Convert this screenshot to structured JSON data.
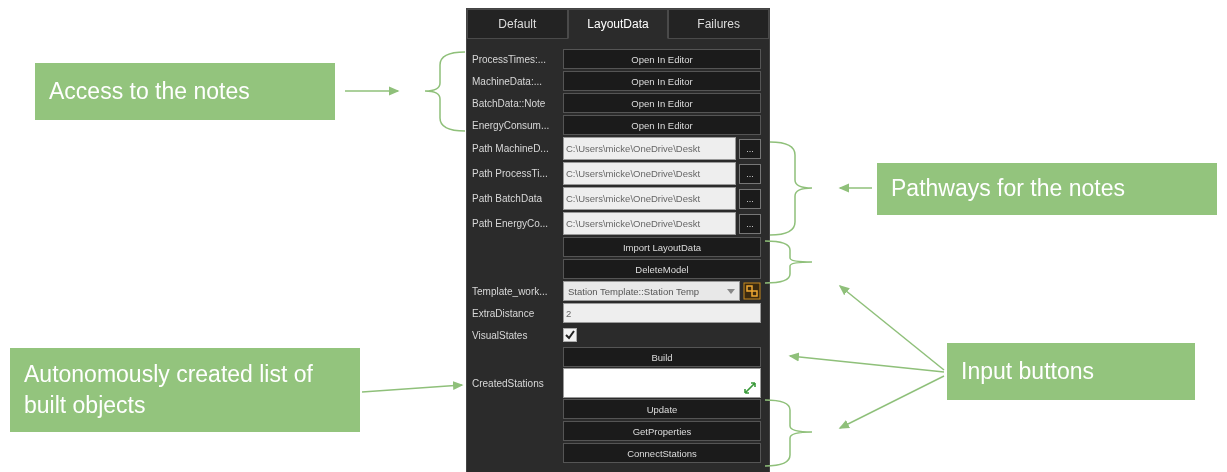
{
  "tabs": [
    {
      "label": "Default",
      "selected": false
    },
    {
      "label": "LayoutData",
      "selected": true
    },
    {
      "label": "Failures",
      "selected": false
    }
  ],
  "properties": [
    {
      "kind": "button",
      "label": "ProcessTimes:...",
      "button": "Open In Editor"
    },
    {
      "kind": "button",
      "label": "MachineData:...",
      "button": "Open In Editor"
    },
    {
      "kind": "button",
      "label": "BatchData::Note",
      "button": "Open In Editor"
    },
    {
      "kind": "button",
      "label": "EnergyConsum...",
      "button": "Open In Editor"
    },
    {
      "kind": "path",
      "label": "Path MachineD...",
      "value": "C:\\Users\\micke\\OneDrive\\Deskt",
      "browse": "..."
    },
    {
      "kind": "path",
      "label": "Path ProcessTi...",
      "value": "C:\\Users\\micke\\OneDrive\\Deskt",
      "browse": "..."
    },
    {
      "kind": "path",
      "label": "Path BatchData",
      "value": "C:\\Users\\micke\\OneDrive\\Deskt",
      "browse": "..."
    },
    {
      "kind": "path",
      "label": "Path EnergyCo...",
      "value": "C:\\Users\\micke\\OneDrive\\Deskt",
      "browse": "..."
    },
    {
      "kind": "action",
      "button": "Import LayoutData"
    },
    {
      "kind": "action",
      "button": "DeleteModel"
    },
    {
      "kind": "dropdown",
      "label": "Template_work...",
      "value": "Station Template::Station Temp"
    },
    {
      "kind": "text",
      "label": "ExtraDistance",
      "value": "2"
    },
    {
      "kind": "checkbox",
      "label": "VisualStates",
      "checked": true
    },
    {
      "kind": "action",
      "button": "Build"
    },
    {
      "kind": "list",
      "label": "CreatedStations"
    },
    {
      "kind": "action",
      "button": "Update"
    },
    {
      "kind": "action",
      "button": "GetProperties"
    },
    {
      "kind": "action",
      "button": "ConnectStations"
    }
  ],
  "callouts": [
    {
      "text": "Access to the notes"
    },
    {
      "text": "Pathways for the notes"
    },
    {
      "text": "Input buttons"
    },
    {
      "text": "Autonomously created list of built objects"
    }
  ]
}
